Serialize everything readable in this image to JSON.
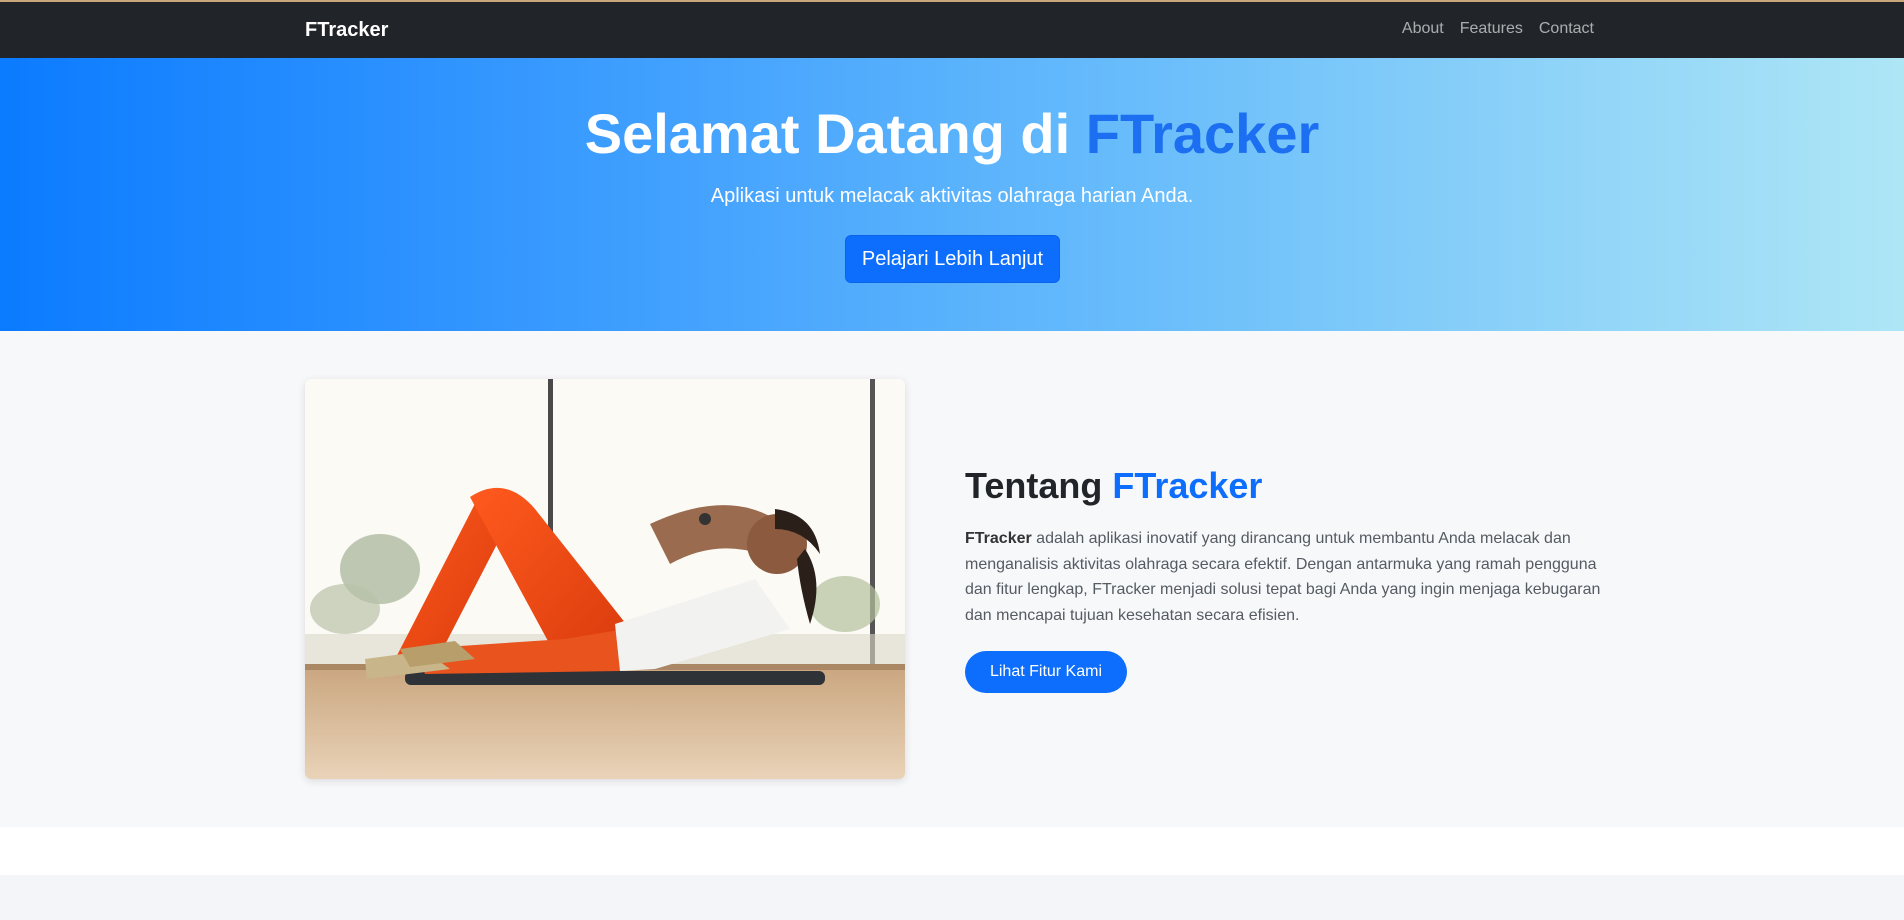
{
  "colors": {
    "navbar_bg": "#212529",
    "primary": "#0d6efd",
    "hero_gradient_start": "#0b7bff",
    "hero_gradient_end": "#aee6f6",
    "about_bg": "#f7f8fa"
  },
  "navbar": {
    "brand": "FTracker",
    "links": [
      {
        "label": "About"
      },
      {
        "label": "Features"
      },
      {
        "label": "Contact"
      }
    ]
  },
  "hero": {
    "title_prefix": "Selamat Datang di ",
    "title_accent": "FTracker",
    "subtitle": "Aplikasi untuk melacak aktivitas olahraga harian Anda.",
    "button_label": "Pelajari Lebih Lanjut"
  },
  "about": {
    "image_alt": "Wanita melakukan sit-up di atas matras",
    "title_prefix": "Tentang ",
    "title_accent": "FTracker",
    "text_brand": "FTracker",
    "text_body": " adalah aplikasi inovatif yang dirancang untuk membantu Anda melacak dan menganalisis aktivitas olahraga secara efektif. Dengan antarmuka yang ramah pengguna dan fitur lengkap, FTracker menjadi solusi tepat bagi Anda yang ingin menjaga kebugaran dan mencapai tujuan kesehatan secara efisien.",
    "button_label": "Lihat Fitur Kami"
  }
}
